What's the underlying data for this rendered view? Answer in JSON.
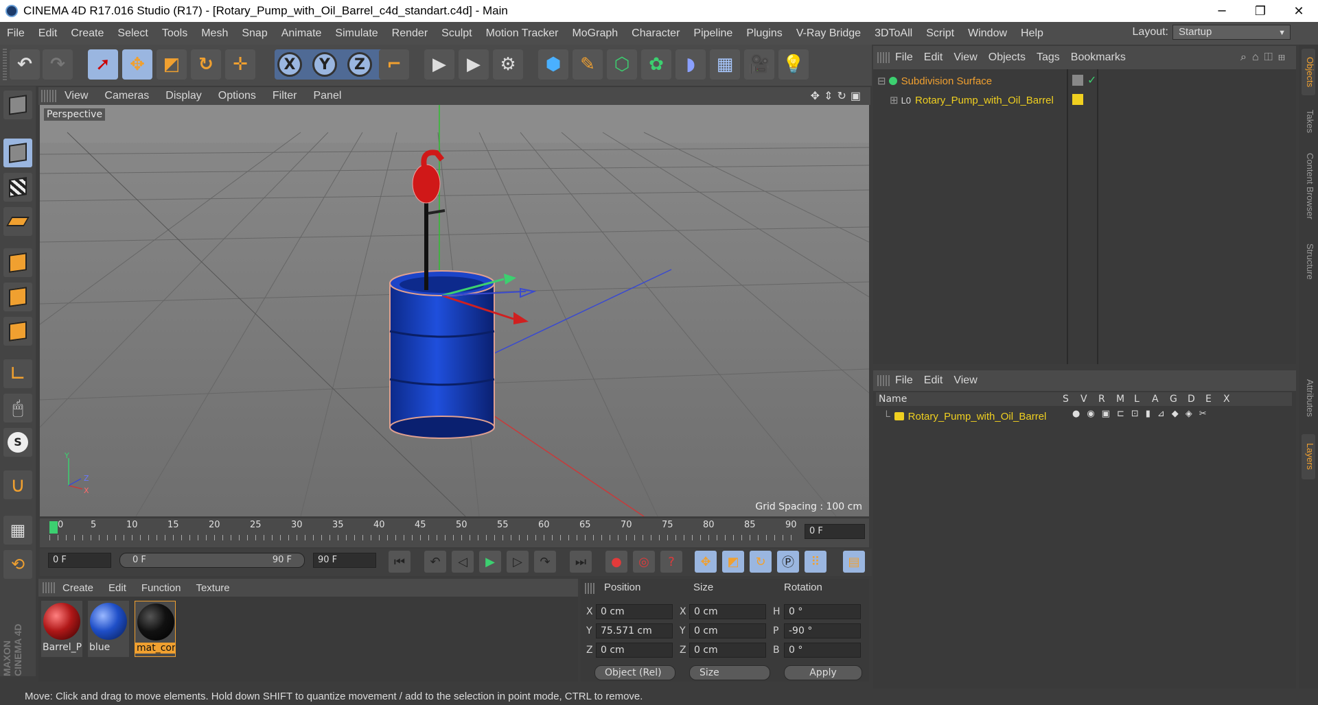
{
  "window": {
    "title": "CINEMA 4D R17.016 Studio (R17) - [Rotary_Pump_with_Oil_Barrel_c4d_standart.c4d] - Main",
    "controls": [
      "minimize-icon",
      "restore-icon",
      "close-icon"
    ]
  },
  "menubar": {
    "items": [
      "File",
      "Edit",
      "Create",
      "Select",
      "Tools",
      "Mesh",
      "Snap",
      "Animate",
      "Simulate",
      "Render",
      "Sculpt",
      "Motion Tracker",
      "MoGraph",
      "Character",
      "Pipeline",
      "Plugins",
      "V-Ray Bridge",
      "3DToAll",
      "Script",
      "Window",
      "Help"
    ],
    "layout_label": "Layout:",
    "layout_value": "Startup"
  },
  "toolbar": {
    "axes": [
      "X",
      "Y",
      "Z"
    ]
  },
  "viewport": {
    "menu": [
      "View",
      "Cameras",
      "Display",
      "Options",
      "Filter",
      "Panel"
    ],
    "camera_label": "Perspective",
    "grid_spacing": "Grid Spacing : 100 cm",
    "axis_labels": {
      "y": "Y",
      "z": "Z",
      "x": "X"
    }
  },
  "timeline": {
    "ticks": [
      "0",
      "5",
      "10",
      "15",
      "20",
      "25",
      "30",
      "35",
      "40",
      "45",
      "50",
      "55",
      "60",
      "65",
      "70",
      "75",
      "80",
      "85",
      "90"
    ],
    "current_frame": "0 F",
    "start_field": "0 F",
    "range_start": "0 F",
    "range_end": "90 F",
    "end_field": "90 F"
  },
  "materials": {
    "menu": [
      "Create",
      "Edit",
      "Function",
      "Texture"
    ],
    "items": [
      {
        "name": "Barrel_P",
        "color": "#b01818"
      },
      {
        "name": "blue",
        "color": "#1f4fc8"
      },
      {
        "name": "mat_cor",
        "color": "#111111"
      }
    ]
  },
  "attributes": {
    "headers": {
      "position": "Position",
      "size": "Size",
      "rotation": "Rotation"
    },
    "rows": [
      {
        "pos_axis": "X",
        "pos": "0 cm",
        "size_axis": "X",
        "size": "0 cm",
        "rot_axis": "H",
        "rot": "0 °"
      },
      {
        "pos_axis": "Y",
        "pos": "75.571 cm",
        "size_axis": "Y",
        "size": "0 cm",
        "rot_axis": "P",
        "rot": "-90 °"
      },
      {
        "pos_axis": "Z",
        "pos": "0 cm",
        "size_axis": "Z",
        "size": "0 cm",
        "rot_axis": "B",
        "rot": "0 °"
      }
    ],
    "coord_mode": "Object (Rel)",
    "size_mode": "Size",
    "apply_label": "Apply"
  },
  "object_manager": {
    "menu": [
      "File",
      "Edit",
      "View",
      "Objects",
      "Tags",
      "Bookmarks"
    ],
    "objects": [
      {
        "name": "Subdivision Surface",
        "color": "#f0a030"
      },
      {
        "name": "Rotary_Pump_with_Oil_Barrel",
        "color": "#f0d020"
      }
    ]
  },
  "layer_manager": {
    "menu": [
      "File",
      "Edit",
      "View"
    ],
    "columns": [
      "Name",
      "S",
      "V",
      "R",
      "M",
      "L",
      "A",
      "G",
      "D",
      "E",
      "X"
    ],
    "layers": [
      {
        "name": "Rotary_Pump_with_Oil_Barrel",
        "color": "#f0d020"
      }
    ]
  },
  "right_tabs": [
    "Objects",
    "Takes",
    "Content Browser",
    "Structure",
    "Attributes",
    "Layers"
  ],
  "left_logo": "MAXON CINEMA 4D",
  "status": "Move: Click and drag to move elements. Hold down SHIFT to quantize movement / add to the selection in point mode, CTRL to remove.",
  "colors": {
    "accent": "#f0a030",
    "ui_bg": "#3c3c3c",
    "panel": "#4a4a4a",
    "viewport": "#7d7d7d"
  }
}
